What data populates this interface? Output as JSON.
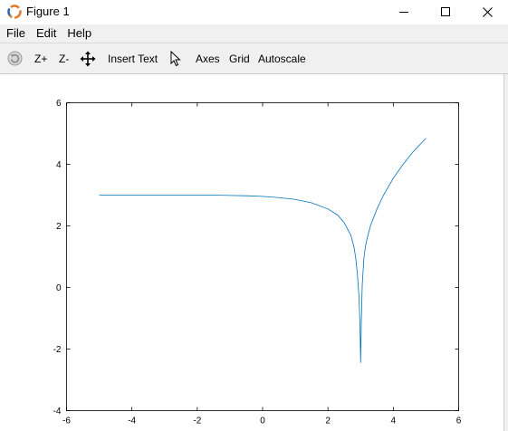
{
  "window": {
    "title": "Figure 1",
    "icon": "octave-logo-icon",
    "controls": [
      "minimize-icon",
      "maximize-icon",
      "close-icon"
    ]
  },
  "menu": {
    "file": "File",
    "edit": "Edit",
    "help": "Help"
  },
  "toolbar": {
    "rotate_icon": "rotate-icon",
    "zoom_in": "Z+",
    "zoom_out": "Z-",
    "pan_icon": "pan-icon",
    "insert_text": "Insert Text",
    "select_icon": "pointer-icon",
    "axes": "Axes",
    "grid": "Grid",
    "autoscale": "Autoscale"
  },
  "colors": {
    "line": "#0072bd",
    "toolbar_bg": "#f0f0f0"
  },
  "chart_data": {
    "type": "line",
    "title": "",
    "xlabel": "",
    "ylabel": "",
    "xlim": [
      -6,
      6
    ],
    "ylim": [
      -4,
      6
    ],
    "xticks": [
      "-6",
      "-4",
      "-2",
      "0",
      "2",
      "4",
      "6"
    ],
    "yticks": [
      "-4",
      "-2",
      "0",
      "2",
      "4",
      "6"
    ],
    "grid": false,
    "series": [
      {
        "x": [
          -5,
          -4,
          -3,
          -2,
          -1.5,
          -1,
          -0.5,
          0,
          0.5,
          1,
          1.5,
          2,
          2.3,
          2.5,
          2.7,
          2.8,
          2.85,
          2.9,
          2.95,
          2.98,
          3.0,
          3.02,
          3.05,
          3.1,
          3.15,
          3.2,
          3.3,
          3.5,
          3.7,
          4.0,
          4.3,
          4.6,
          5.0
        ],
        "y": [
          3.0,
          3.0,
          3.0,
          3.0,
          3.0,
          2.99,
          2.98,
          2.96,
          2.92,
          2.86,
          2.75,
          2.55,
          2.35,
          2.1,
          1.7,
          1.3,
          0.95,
          0.45,
          -0.3,
          -1.2,
          -2.45,
          -1.2,
          0.1,
          0.95,
          1.35,
          1.6,
          2.0,
          2.55,
          3.0,
          3.55,
          4.0,
          4.4,
          4.85
        ]
      }
    ]
  }
}
